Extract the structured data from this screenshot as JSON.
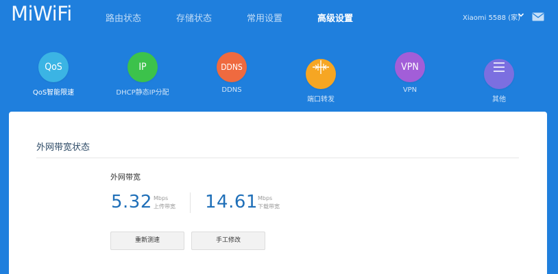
{
  "header": {
    "logo": "MiWiFi",
    "nav": [
      {
        "label": "路由状态",
        "active": false
      },
      {
        "label": "存储状态",
        "active": false
      },
      {
        "label": "常用设置",
        "active": false
      },
      {
        "label": "高级设置",
        "active": true
      }
    ],
    "user": "Xiaomi 5588 (家)",
    "icons": {
      "caret": "chevron-down-icon",
      "mail": "mail-icon"
    }
  },
  "features": [
    {
      "icon_text": "QoS",
      "label": "QoS智能限速",
      "color": "#3bb4e4",
      "active": true
    },
    {
      "icon_text": "IP",
      "label": "DHCP静态IP分配",
      "color": "#3cc24b",
      "active": false
    },
    {
      "icon_text": "DDNS",
      "label": "DDNS",
      "color": "#ef6a3f",
      "active": false
    },
    {
      "icon_text": "",
      "icon": "port-forward-icon",
      "label": "端口转发",
      "color": "#f6a623",
      "active": false
    },
    {
      "icon_text": "VPN",
      "label": "VPN",
      "color": "#a25ed8",
      "active": false
    },
    {
      "icon_text": "",
      "icon": "menu-icon",
      "label": "其他",
      "color": "#7b6fe0",
      "active": false
    }
  ],
  "panel": {
    "title": "外网带宽状态",
    "bandwidth_label": "外网带宽",
    "upload": {
      "value": "5.32",
      "unit": "Mbps",
      "desc": "上传带宽"
    },
    "download": {
      "value": "14.61",
      "unit": "Mbps",
      "desc": "下载带宽"
    },
    "buttons": {
      "retest": "重新测速",
      "manual": "手工修改"
    }
  }
}
